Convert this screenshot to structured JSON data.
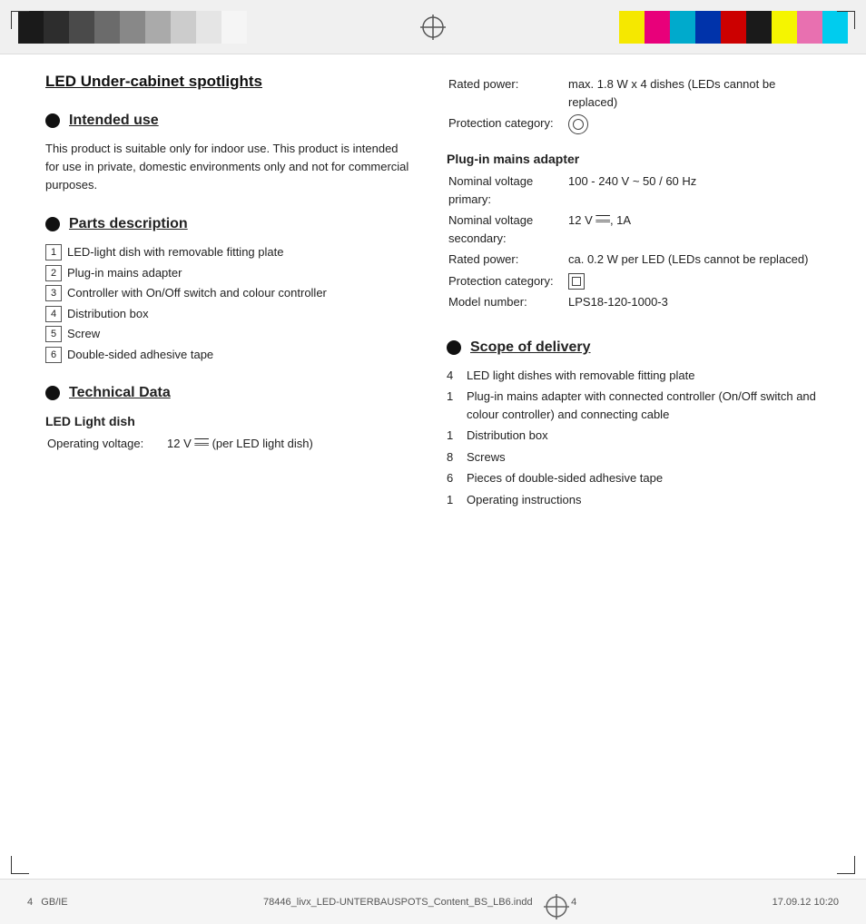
{
  "top_bar": {
    "swatches_left": [
      "#1a1a1a",
      "#2d2d2d",
      "#4a4a4a",
      "#6b6b6b",
      "#888888",
      "#aaaaaa",
      "#cccccc",
      "#e5e5e5",
      "#f5f5f5"
    ],
    "swatches_right": [
      "#f5e800",
      "#e8007a",
      "#00aacc",
      "#0033aa",
      "#cc0000",
      "#1a1a1a",
      "#f5f500",
      "#e870b0",
      "#00ccee"
    ]
  },
  "page_title": "LED Under-cabinet spotlights",
  "sections": {
    "intended_use": {
      "heading": "Intended use",
      "body": "This product is suitable only for indoor use. This product is intended for use in private, domestic environments only and not for commercial purposes."
    },
    "parts_description": {
      "heading": "Parts description",
      "items": [
        {
          "num": "1",
          "text": "LED-light dish with removable fitting plate"
        },
        {
          "num": "2",
          "text": "Plug-in mains adapter"
        },
        {
          "num": "3",
          "text": "Controller with On/Off switch and colour controller"
        },
        {
          "num": "4",
          "text": "Distribution box"
        },
        {
          "num": "5",
          "text": "Screw"
        },
        {
          "num": "6",
          "text": "Double-sided adhesive tape"
        }
      ]
    },
    "technical_data": {
      "heading": "Technical Data",
      "led_light_dish": {
        "subtitle": "LED Light dish",
        "operating_voltage_label": "Operating voltage:",
        "operating_voltage_value": "12 V ═══ (per LED light dish)"
      },
      "right_col": {
        "rated_power_label": "Rated power:",
        "rated_power_value": "max. 1.8 W x 4 dishes (LEDs cannot be replaced)",
        "protection_category_label": "Protection category:",
        "plug_in_adapter": {
          "subtitle": "Plug-in mains adapter",
          "nominal_voltage_primary_label": "Nominal voltage primary:",
          "nominal_voltage_primary_value": "100 - 240 V ~ 50 / 60 Hz",
          "nominal_voltage_secondary_label": "Nominal voltage secondary:",
          "nominal_voltage_secondary_value": "12 V ═══, 1A",
          "rated_power_label": "Rated power:",
          "rated_power_value": "ca. 0.2 W per LED (LEDs cannot be replaced)",
          "protection_category_label": "Protection category:",
          "model_number_label": "Model number:",
          "model_number_value": "LPS18-120-1000-3"
        }
      }
    },
    "scope_of_delivery": {
      "heading": "Scope of delivery",
      "items": [
        {
          "qty": "4",
          "text": "LED light dishes with removable fitting plate"
        },
        {
          "qty": "1",
          "text": "Plug-in mains adapter with connected controller (On/Off switch and colour controller) and connecting cable"
        },
        {
          "qty": "1",
          "text": "Distribution box"
        },
        {
          "qty": "8",
          "text": "Screws"
        },
        {
          "qty": "6",
          "text": "Pieces of double-sided adhesive tape"
        },
        {
          "qty": "1",
          "text": "Operating instructions"
        }
      ]
    }
  },
  "footer": {
    "page_num": "4",
    "locale": "GB/IE",
    "filename": "78446_livx_LED-UNTERBAUSPOTS_Content_BS_LB6.indd",
    "page_indicator": "4",
    "timestamp": "17.09.12   10:20"
  }
}
